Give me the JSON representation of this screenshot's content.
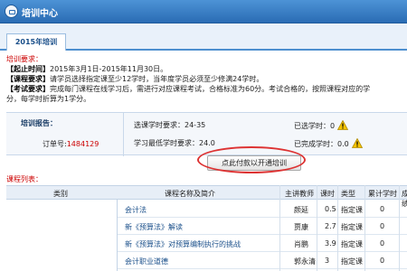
{
  "header": {
    "title": "培训中心"
  },
  "tab": {
    "label": "2015年培训"
  },
  "notice": {
    "title": "培训要求：",
    "line1_label": "【起止时间】",
    "line1_text": "2015年3月1日-2015年11月30日。",
    "line2_label": "【课程要求】",
    "line2_text": "请学员选择指定课至少12学时，当年度学员必须至少修满24学时。",
    "line3_label": "【考试要求】",
    "line3_text": "完成每门课程在线学习后，需进行对应课程考试，合格标准为60分。考试合格的，按照课程对应的学",
    "line4_text": "分，每学时折算为1学分。"
  },
  "report": {
    "title": "培训报告：",
    "order_label": "订单号:",
    "order_number": "1484129",
    "selected_hours_label": "选课学时要求：",
    "selected_hours_value": "24-35",
    "already_selected_label": "已选学时：",
    "already_selected_value": "0",
    "min_hours_label": "学习最低学时要求：",
    "min_hours_value": "24.0",
    "completed_label": "已完成学时：",
    "completed_value": "0.0"
  },
  "pay_button": {
    "label": "点此付款以开通培训"
  },
  "list_label": "课程列表：",
  "table": {
    "headers": [
      "类别",
      "课程名称及简介",
      "主讲教师",
      "课时",
      "类型",
      "累计学时",
      "成绩"
    ],
    "rows": [
      {
        "course": "会计法",
        "teacher": "颜延",
        "hours": "0.5",
        "type": "指定课",
        "acc": "0"
      },
      {
        "course": "新《预算法》解读",
        "teacher": "贾康",
        "hours": "2.7",
        "type": "指定课",
        "acc": "0"
      },
      {
        "course": "新《预算法》对预算编制执行的挑战",
        "teacher": "肖鹏",
        "hours": "3.9",
        "type": "指定课",
        "acc": "0"
      },
      {
        "course": "会计职业道德",
        "teacher": "郭永清",
        "hours": "3",
        "type": "指定课",
        "acc": "0"
      }
    ]
  },
  "colors": {
    "header_blue": "#2a6cb4",
    "notice_red": "#cc0000",
    "order_red": "#cc0000",
    "warning_yellow": "#f5c400"
  }
}
